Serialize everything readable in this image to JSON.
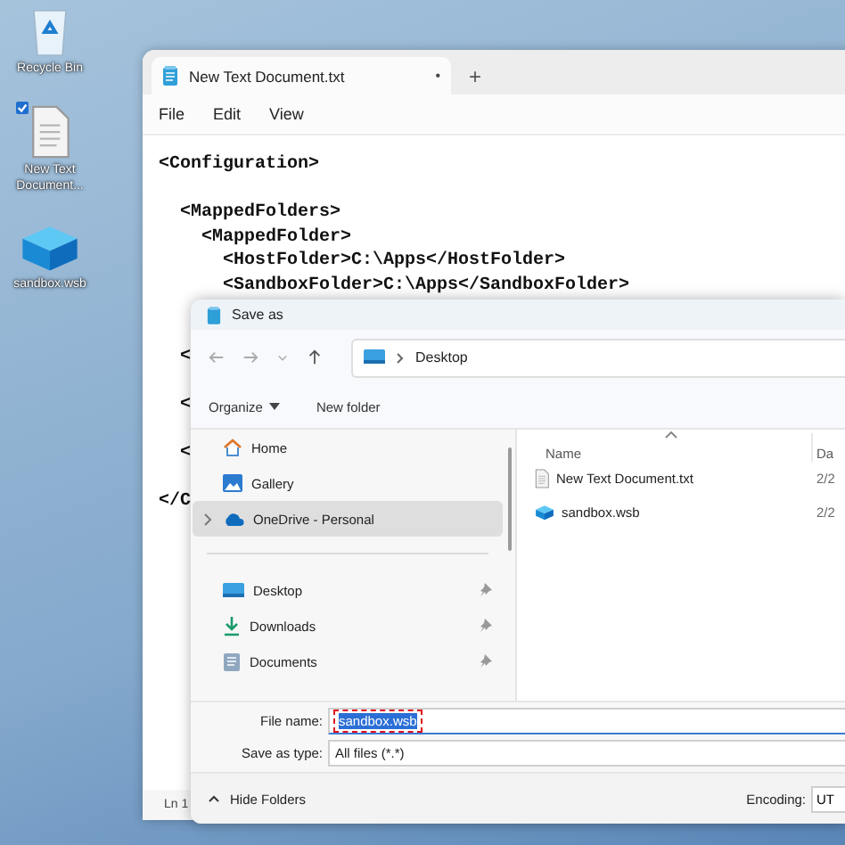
{
  "desktop_icons": [
    {
      "label": "Recycle Bin",
      "kind": "recycle",
      "selected": false
    },
    {
      "label": "New Text Document...",
      "kind": "text",
      "selected": true
    },
    {
      "label": "sandbox.wsb",
      "kind": "sandbox",
      "selected": false
    }
  ],
  "notepad": {
    "tab": {
      "title": "New Text Document.txt",
      "mark": "•"
    },
    "new_tab": "+",
    "menu": [
      "File",
      "Edit",
      "View"
    ],
    "lines": [
      {
        "kind": "code",
        "text": "<Configuration>"
      },
      {
        "kind": "blank"
      },
      {
        "kind": "code",
        "text": "  <MappedFolders>"
      },
      {
        "kind": "code",
        "text": "    <MappedFolder>"
      },
      {
        "kind": "code",
        "text": "      <HostFolder>C:\\Apps</HostFolder>"
      },
      {
        "kind": "code",
        "text": "      <SandboxFolder>C:\\Apps</SandboxFolder>"
      },
      {
        "kind": "blank"
      },
      {
        "kind": "blank"
      },
      {
        "kind": "code",
        "text": "  <"
      },
      {
        "kind": "blank"
      },
      {
        "kind": "code",
        "text": "  <"
      },
      {
        "kind": "blank"
      },
      {
        "kind": "code",
        "text": "  <"
      },
      {
        "kind": "blank"
      },
      {
        "kind": "code",
        "text": "</C"
      }
    ],
    "status": "Ln 1"
  },
  "dialog": {
    "title": "Save as",
    "address": "Desktop",
    "toolbar": [
      {
        "label": "Organize",
        "dropdown": true
      },
      {
        "label": "New folder",
        "dropdown": false
      }
    ],
    "nav_items": [
      {
        "label": "Home",
        "kind": "home",
        "selected": false,
        "expandable": false
      },
      {
        "label": "Gallery",
        "kind": "gallery",
        "selected": false,
        "expandable": false
      },
      {
        "label": "OneDrive - Personal",
        "kind": "cloud",
        "selected": true,
        "expandable": true
      }
    ],
    "quick_access": [
      {
        "label": "Desktop",
        "kind": "desktop",
        "pinned": true
      },
      {
        "label": "Downloads",
        "kind": "download",
        "pinned": true
      },
      {
        "label": "Documents",
        "kind": "documents",
        "pinned": true
      }
    ],
    "columns": [
      {
        "label": "Name",
        "sorted": true
      },
      {
        "label": "Da",
        "sorted": false
      }
    ],
    "files": [
      {
        "name": "New Text Document.txt",
        "kind": "text",
        "date": "2/2"
      },
      {
        "name": "sandbox.wsb",
        "kind": "sandbox",
        "date": "2/2"
      }
    ],
    "file_name": {
      "label": "File name:",
      "value": "sandbox.wsb",
      "selected": true,
      "annotated": true
    },
    "save_type": {
      "label": "Save as type:",
      "value": "All files  (*.*)"
    },
    "hide_folders": "Hide Folders",
    "encoding": {
      "label": "Encoding:",
      "value": "UT"
    }
  }
}
